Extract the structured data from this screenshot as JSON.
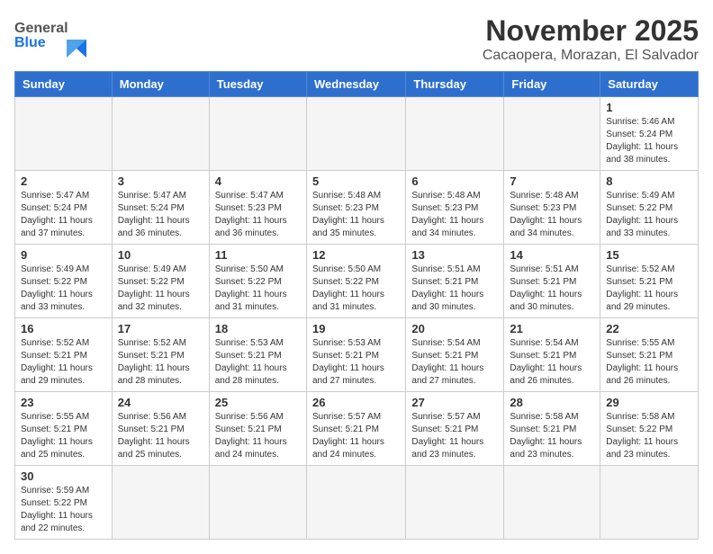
{
  "header": {
    "logo_general": "General",
    "logo_blue": "Blue",
    "month": "November 2025",
    "location": "Cacaopera, Morazan, El Salvador"
  },
  "weekdays": [
    "Sunday",
    "Monday",
    "Tuesday",
    "Wednesday",
    "Thursday",
    "Friday",
    "Saturday"
  ],
  "weeks": [
    [
      {
        "day": "",
        "info": ""
      },
      {
        "day": "",
        "info": ""
      },
      {
        "day": "",
        "info": ""
      },
      {
        "day": "",
        "info": ""
      },
      {
        "day": "",
        "info": ""
      },
      {
        "day": "",
        "info": ""
      },
      {
        "day": "1",
        "info": "Sunrise: 5:46 AM\nSunset: 5:24 PM\nDaylight: 11 hours\nand 38 minutes."
      }
    ],
    [
      {
        "day": "2",
        "info": "Sunrise: 5:47 AM\nSunset: 5:24 PM\nDaylight: 11 hours\nand 37 minutes."
      },
      {
        "day": "3",
        "info": "Sunrise: 5:47 AM\nSunset: 5:24 PM\nDaylight: 11 hours\nand 36 minutes."
      },
      {
        "day": "4",
        "info": "Sunrise: 5:47 AM\nSunset: 5:23 PM\nDaylight: 11 hours\nand 36 minutes."
      },
      {
        "day": "5",
        "info": "Sunrise: 5:48 AM\nSunset: 5:23 PM\nDaylight: 11 hours\nand 35 minutes."
      },
      {
        "day": "6",
        "info": "Sunrise: 5:48 AM\nSunset: 5:23 PM\nDaylight: 11 hours\nand 34 minutes."
      },
      {
        "day": "7",
        "info": "Sunrise: 5:48 AM\nSunset: 5:23 PM\nDaylight: 11 hours\nand 34 minutes."
      },
      {
        "day": "8",
        "info": "Sunrise: 5:49 AM\nSunset: 5:22 PM\nDaylight: 11 hours\nand 33 minutes."
      }
    ],
    [
      {
        "day": "9",
        "info": "Sunrise: 5:49 AM\nSunset: 5:22 PM\nDaylight: 11 hours\nand 33 minutes."
      },
      {
        "day": "10",
        "info": "Sunrise: 5:49 AM\nSunset: 5:22 PM\nDaylight: 11 hours\nand 32 minutes."
      },
      {
        "day": "11",
        "info": "Sunrise: 5:50 AM\nSunset: 5:22 PM\nDaylight: 11 hours\nand 31 minutes."
      },
      {
        "day": "12",
        "info": "Sunrise: 5:50 AM\nSunset: 5:22 PM\nDaylight: 11 hours\nand 31 minutes."
      },
      {
        "day": "13",
        "info": "Sunrise: 5:51 AM\nSunset: 5:21 PM\nDaylight: 11 hours\nand 30 minutes."
      },
      {
        "day": "14",
        "info": "Sunrise: 5:51 AM\nSunset: 5:21 PM\nDaylight: 11 hours\nand 30 minutes."
      },
      {
        "day": "15",
        "info": "Sunrise: 5:52 AM\nSunset: 5:21 PM\nDaylight: 11 hours\nand 29 minutes."
      }
    ],
    [
      {
        "day": "16",
        "info": "Sunrise: 5:52 AM\nSunset: 5:21 PM\nDaylight: 11 hours\nand 29 minutes."
      },
      {
        "day": "17",
        "info": "Sunrise: 5:52 AM\nSunset: 5:21 PM\nDaylight: 11 hours\nand 28 minutes."
      },
      {
        "day": "18",
        "info": "Sunrise: 5:53 AM\nSunset: 5:21 PM\nDaylight: 11 hours\nand 28 minutes."
      },
      {
        "day": "19",
        "info": "Sunrise: 5:53 AM\nSunset: 5:21 PM\nDaylight: 11 hours\nand 27 minutes."
      },
      {
        "day": "20",
        "info": "Sunrise: 5:54 AM\nSunset: 5:21 PM\nDaylight: 11 hours\nand 27 minutes."
      },
      {
        "day": "21",
        "info": "Sunrise: 5:54 AM\nSunset: 5:21 PM\nDaylight: 11 hours\nand 26 minutes."
      },
      {
        "day": "22",
        "info": "Sunrise: 5:55 AM\nSunset: 5:21 PM\nDaylight: 11 hours\nand 26 minutes."
      }
    ],
    [
      {
        "day": "23",
        "info": "Sunrise: 5:55 AM\nSunset: 5:21 PM\nDaylight: 11 hours\nand 25 minutes."
      },
      {
        "day": "24",
        "info": "Sunrise: 5:56 AM\nSunset: 5:21 PM\nDaylight: 11 hours\nand 25 minutes."
      },
      {
        "day": "25",
        "info": "Sunrise: 5:56 AM\nSunset: 5:21 PM\nDaylight: 11 hours\nand 24 minutes."
      },
      {
        "day": "26",
        "info": "Sunrise: 5:57 AM\nSunset: 5:21 PM\nDaylight: 11 hours\nand 24 minutes."
      },
      {
        "day": "27",
        "info": "Sunrise: 5:57 AM\nSunset: 5:21 PM\nDaylight: 11 hours\nand 23 minutes."
      },
      {
        "day": "28",
        "info": "Sunrise: 5:58 AM\nSunset: 5:21 PM\nDaylight: 11 hours\nand 23 minutes."
      },
      {
        "day": "29",
        "info": "Sunrise: 5:58 AM\nSunset: 5:22 PM\nDaylight: 11 hours\nand 23 minutes."
      }
    ],
    [
      {
        "day": "30",
        "info": "Sunrise: 5:59 AM\nSunset: 5:22 PM\nDaylight: 11 hours\nand 22 minutes."
      },
      {
        "day": "",
        "info": ""
      },
      {
        "day": "",
        "info": ""
      },
      {
        "day": "",
        "info": ""
      },
      {
        "day": "",
        "info": ""
      },
      {
        "day": "",
        "info": ""
      },
      {
        "day": "",
        "info": ""
      }
    ]
  ]
}
